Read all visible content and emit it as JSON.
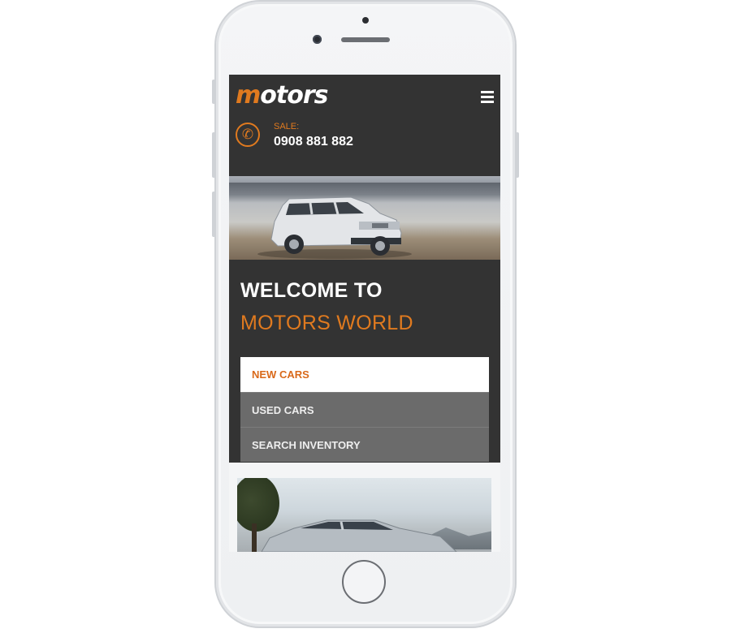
{
  "header": {
    "logo_prefix": "m",
    "logo_rest": "otors",
    "sale_label": "SALE:",
    "sale_number": "0908 881 882"
  },
  "welcome": {
    "line1": "WELCOME TO",
    "line2": "MOTORS WORLD"
  },
  "nav": {
    "items": [
      {
        "label": "NEW CARS"
      },
      {
        "label": "USED CARS"
      },
      {
        "label": "SEARCH INVENTORY"
      }
    ]
  },
  "icons": {
    "menu": "hamburger-icon",
    "phone": "phone-icon"
  },
  "colors": {
    "accent": "#e07a1f",
    "header_bg": "#333333",
    "nav_dark": "#6b6b6b"
  }
}
